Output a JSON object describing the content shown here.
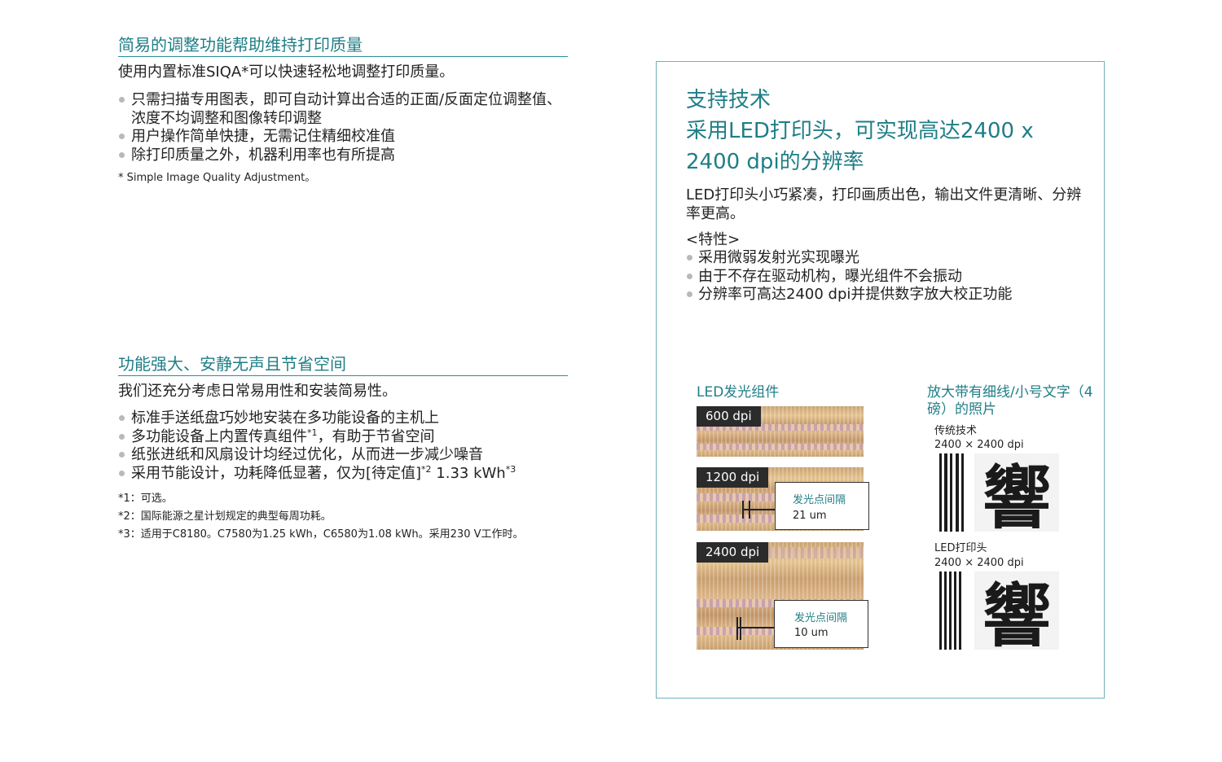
{
  "section1": {
    "heading": "简易的调整功能帮助维持打印质量",
    "lead": "使用内置标准SIQA*可以快速轻松地调整打印质量。",
    "bullets": [
      "只需扫描专用图表，即可自动计算出合适的正面/反面定位调整值、浓度不均调整和图像转印调整",
      "用户操作简单快捷，无需记住精细校准值",
      "除打印质量之外，机器利用率也有所提高"
    ],
    "note": "* Simple Image Quality Adjustment。"
  },
  "section2": {
    "heading": "功能强大、安静无声且节省空间",
    "lead": "我们还充分考虑日常易用性和安装简易性。",
    "bullets": {
      "b1": "标准手送纸盘巧妙地安装在多功能设备的主机上",
      "b2_a": "多功能设备上内置传真组件",
      "b2_sup": "*1",
      "b2_b": "，有助于节省空间",
      "b3": "纸张进纸和风扇设计均经过优化，从而进一步减少噪音",
      "b4_a": "采用节能设计，功耗降低显著，仅为[待定值]",
      "b4_sup1": "*2",
      "b4_b": " 1.33 kWh",
      "b4_sup2": "*3"
    },
    "notes": [
      "*1：可选。",
      "*2：国际能源之星计划规定的典型每周功耗。",
      "*3：适用于C8180。C7580为1.25 kWh，C6580为1.08 kWh。采用230 V工作时。"
    ]
  },
  "panel": {
    "title1": "支持技术",
    "title2": "采用LED打印头，可实现高达2400 x",
    "title3": "2400 dpi的分辨率",
    "intro": "LED打印头小巧紧凑，打印画质出色，输出文件更清晰、分辨率更高。",
    "features_label": "<特性>",
    "features": [
      "采用微弱发射光实现曝光",
      "由于不存在驱动机构，曝光组件不会振动",
      "分辨率可高达2400 dpi并提供数字放大校正功能"
    ],
    "led_caption": "LED发光组件",
    "photos": [
      {
        "label": "600 dpi"
      },
      {
        "label": "1200 dpi",
        "callout_title": "发光点间隔",
        "callout_value": "21 um"
      },
      {
        "label": "2400 dpi",
        "callout_title": "发光点间隔",
        "callout_value": "10 um"
      }
    ],
    "zoom_caption": "放大带有细线/小号文字（4磅）的照片",
    "traditional_label": "传统技术",
    "traditional_res": "2400 × 2400 dpi",
    "led_head_label": "LED打印头",
    "led_head_res": "2400 × 2400 dpi",
    "sample_char": "響"
  }
}
